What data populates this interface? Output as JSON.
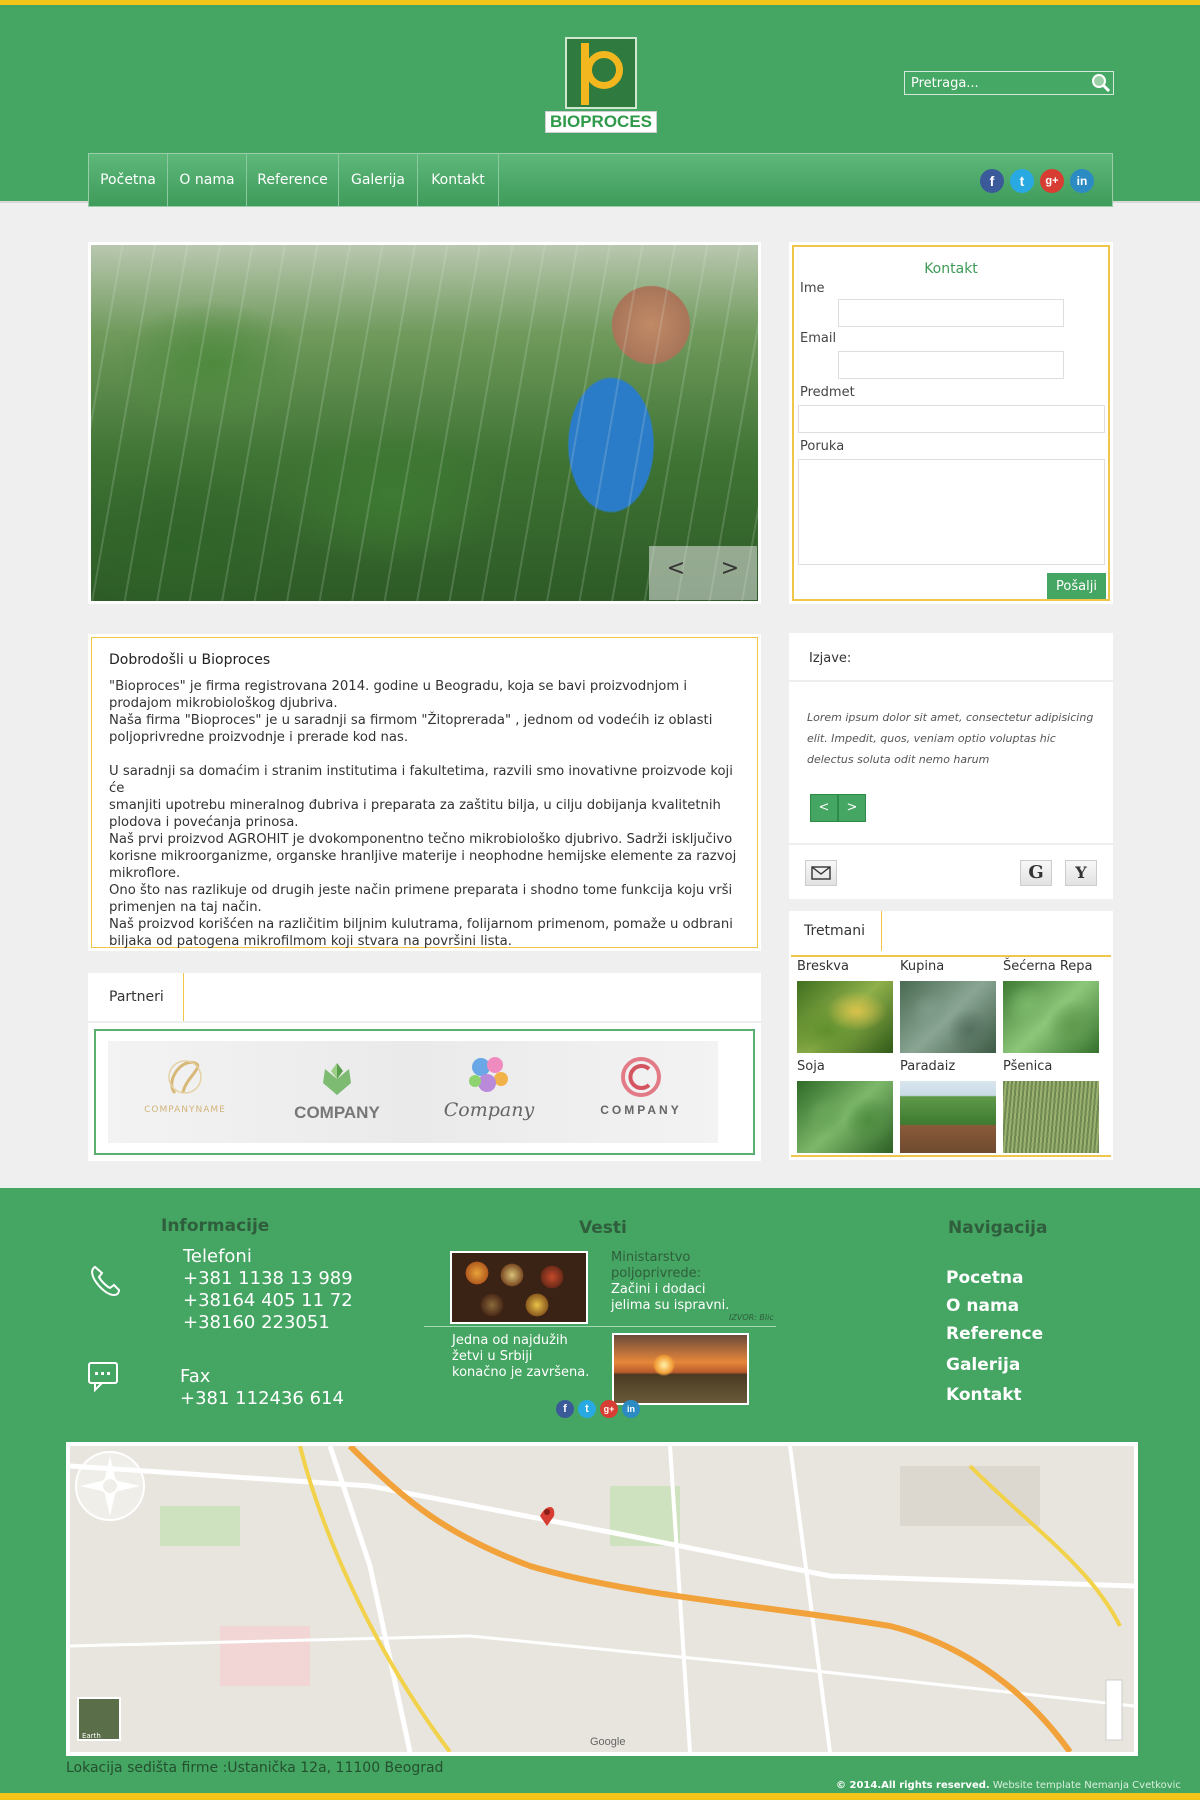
{
  "header": {
    "logo_text": "BIOPROCES",
    "search_placeholder": "Pretraga...",
    "nav": [
      "Početna",
      "O nama",
      "Reference",
      "Galerija",
      "Kontakt"
    ],
    "social": [
      "f",
      "t",
      "g+",
      "in"
    ]
  },
  "slider": {
    "prev": "<",
    "next": ">"
  },
  "contact_form": {
    "title": "Kontakt",
    "name_label": "Ime",
    "email_label": "Email",
    "subject_label": "Predmet",
    "message_label": "Poruka",
    "send_label": "Pošalji"
  },
  "welcome": {
    "title": "Dobrodošli u Bioproces",
    "lines": [
      "\"Bioproces\"  je firma registrovana 2014. godine u Beogradu, koja se bavi proizvodnjom i",
      "prodajom mikrobiološkog djubriva.",
      "Naša firma \"Bioproces\" je  u saradnji sa firmom \"Žitoprerada\" , jednom od vodećih iz oblasti",
      "poljoprivredne proizvodnje i prerade kod nas.",
      "",
      "U saradnji sa domaćim i stranim institutima i fakultetima, razvili smo inovativne proizvode koji će",
      "smanjiti upotrebu mineralnog đubriva i preparata za zaštitu bilja, u cilju dobijanja kvalitetnih",
      "plodova i povećanja prinosa.",
      "Naš prvi proizvod AGROHIT je dvokomponentno tečno mikrobiološko djubrivo. Sadrži isključivo",
      "korisne mikroorganizme, organske hranljive materije i neophodne hemijske elemente za razvoj",
      "mikroflore.",
      "Ono što nas razlikuje od drugih jeste način primene preparata i shodno tome funkcija koju vrši",
      "primenjen na taj način.",
      "Naš proizvod korišćen na različitim biljnim kulutrama, folijarnom primenom, pomaže u odbrani",
      "biljaka od patogena mikrofilmom koji stvara na površini lista."
    ]
  },
  "partners": {
    "title": "Partneri",
    "logos": [
      "COMPANYNAME",
      "COMPANY",
      "Company",
      "COMPANY"
    ]
  },
  "testimonials": {
    "title": "Izjave:",
    "quote": "Lorem ipsum dolor sit amet, consectetur adipisicing elit. Impedit, quos, veniam optio voluptas hic delectus soluta odit nemo harum",
    "prev": "<",
    "next": ">",
    "google": "G",
    "yahoo": "Y"
  },
  "treatments": {
    "title": "Tretmani",
    "items": [
      "Breskva",
      "Kupina",
      "Šećerna Repa",
      "Soja",
      "Paradaiz",
      "Pšenica"
    ]
  },
  "footer": {
    "info_title": "Informacije",
    "phones_label": "Telefoni",
    "phones": [
      "+381 1138 13 989",
      "+38164 405 11 72",
      "+38160 223051"
    ],
    "fax_label": "Fax",
    "fax": "+381 112436 614",
    "news_title": "Vesti",
    "news1": [
      "Ministarstvo",
      "poljoprivrede:",
      "Začini i dodaci",
      "jelima su ispravni."
    ],
    "news1_source": "IZVOR: Blic",
    "news2": [
      "Jedna od najdužih",
      " žetvi u Srbiji",
      "konačno je završena."
    ],
    "nav_title": "Navigacija",
    "nav": [
      "Pocetna",
      "O nama",
      "Reference",
      "Galerija",
      "Kontakt"
    ],
    "location": "Lokacija sedišta firme :Ustanička 12a, 11100 Beograd",
    "copyright": "© 2014.All rights reserved.",
    "credit": "Website template Nemanja Cvetkovic",
    "map_google": "Google",
    "map_earth": "Earth"
  },
  "colors": {
    "brand_green": "#45a562",
    "accent_yellow": "#f2c518",
    "border_gold": "#f0c64a"
  }
}
